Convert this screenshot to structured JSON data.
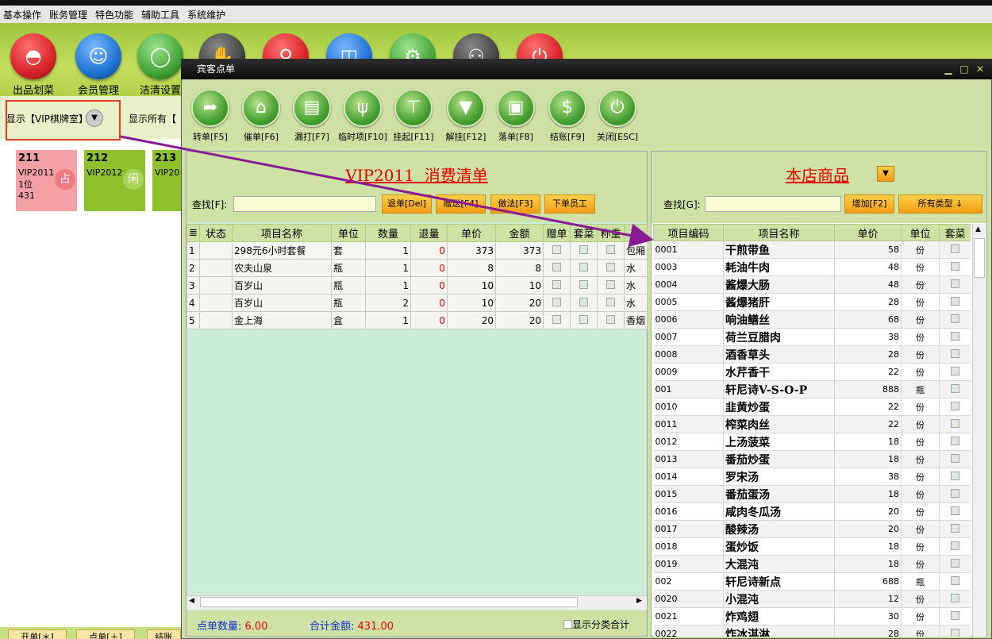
{
  "menu": [
    "基本操作",
    "账务管理",
    "特色功能",
    "辅助工具",
    "系统维护"
  ],
  "main_toolbar": [
    {
      "label": "出品划菜",
      "color": "#d8232a",
      "icon": "cloche-icon"
    },
    {
      "label": "会员管理",
      "color": "#1f74d6",
      "icon": "user-icon"
    },
    {
      "label": "洁清设置",
      "color": "#45a63a",
      "icon": "plate-icon"
    },
    {
      "label": "",
      "color": "#444",
      "icon": "hand-icon"
    },
    {
      "label": "",
      "color": "#d8232a",
      "icon": "search-icon"
    },
    {
      "label": "",
      "color": "#1f74d6",
      "icon": "bag-icon"
    },
    {
      "label": "",
      "color": "#45a63a",
      "icon": "settings-icon"
    },
    {
      "label": "",
      "color": "#444",
      "icon": "people-icon"
    },
    {
      "label": "",
      "color": "#d8232a",
      "icon": "power-icon"
    }
  ],
  "filter": {
    "current": "显示【VIP棋牌室】",
    "show_all": "显示所有【"
  },
  "rooms": [
    {
      "number": "211",
      "name": "VIP2011",
      "guests": "1位",
      "amount": "431",
      "badge": "占",
      "color": "#f4a0a4"
    },
    {
      "number": "212",
      "name": "VIP2012",
      "guests": "",
      "amount": "",
      "badge": "闲",
      "color": "#8dc22c"
    },
    {
      "number": "213",
      "name": "VIP20",
      "guests": "",
      "amount": "",
      "badge": "",
      "color": "#8dc22c"
    }
  ],
  "bottom_buttons": [
    "开单[＊]",
    "点单[＋]",
    "结账"
  ],
  "dialog": {
    "title": "宾客点单",
    "toolbar": [
      {
        "label": "转单[F5]",
        "icon": "forward-icon",
        "glyph": "➦"
      },
      {
        "label": "催单[F6]",
        "icon": "bank-icon",
        "glyph": "⌂"
      },
      {
        "label": "漏打[F7]",
        "icon": "document-icon",
        "glyph": "▤"
      },
      {
        "label": "临时项[F10]",
        "icon": "fork-knife-icon",
        "glyph": "ψ"
      },
      {
        "label": "挂起[F11]",
        "icon": "tie-rack-icon",
        "glyph": "⊤"
      },
      {
        "label": "解挂[F12]",
        "icon": "tie-icon",
        "glyph": "▼"
      },
      {
        "label": "落单[F8]",
        "icon": "screen-icon",
        "glyph": "▣"
      },
      {
        "label": "结账[F9]",
        "icon": "dollar-icon",
        "glyph": "$"
      },
      {
        "label": "关闭[ESC]",
        "icon": "power-icon",
        "glyph": "⏻"
      }
    ],
    "order": {
      "title": "VIP2011  消费清单",
      "search_label": "查找[F]:",
      "buttons": [
        "退单[Del]",
        "赠送[F4]",
        "做法[F3]",
        "下单员工"
      ],
      "columns": [
        "≣",
        "状态",
        "项目名称",
        "单位",
        "数量",
        "退量",
        "单价",
        "金额",
        "赠单",
        "套菜",
        "称重",
        "商"
      ],
      "rows": [
        {
          "idx": "1",
          "status": "",
          "name": "298元6小时套餐",
          "unit": "套",
          "qty": "1",
          "ret": "0",
          "price": "373",
          "amount": "373",
          "extra": "包厢"
        },
        {
          "idx": "2",
          "status": "",
          "name": "农夫山泉",
          "unit": "瓶",
          "qty": "1",
          "ret": "0",
          "price": "8",
          "amount": "8",
          "extra": "水"
        },
        {
          "idx": "3",
          "status": "",
          "name": "百岁山",
          "unit": "瓶",
          "qty": "1",
          "ret": "0",
          "price": "10",
          "amount": "10",
          "extra": "水"
        },
        {
          "idx": "4",
          "status": "",
          "name": "百岁山",
          "unit": "瓶",
          "qty": "2",
          "ret": "0",
          "price": "10",
          "amount": "20",
          "extra": "水"
        },
        {
          "idx": "5",
          "status": "",
          "name": "金上海",
          "unit": "盒",
          "qty": "1",
          "ret": "0",
          "price": "20",
          "amount": "20",
          "extra": "香烟"
        }
      ],
      "count_label": "点单数量:",
      "count_value": "6.00",
      "total_label": "合计金额:",
      "total_value": "431.00",
      "show_category": "显示分类合计"
    },
    "products": {
      "title": "本店商品",
      "search_label": "查找[G]:",
      "add_button": "增加[F2]",
      "type_button": "所有类型 ↓",
      "columns": [
        "项目编码",
        "项目名称",
        "单价",
        "单位",
        "套菜"
      ],
      "rows": [
        {
          "code": "0001",
          "name": "干煎带鱼",
          "price": "58",
          "unit": "份"
        },
        {
          "code": "0003",
          "name": "耗油牛肉",
          "price": "48",
          "unit": "份"
        },
        {
          "code": "0004",
          "name": "酱爆大肠",
          "price": "48",
          "unit": "份"
        },
        {
          "code": "0005",
          "name": "酱爆猪肝",
          "price": "28",
          "unit": "份"
        },
        {
          "code": "0006",
          "name": "响油鳝丝",
          "price": "68",
          "unit": "份"
        },
        {
          "code": "0007",
          "name": "荷兰豆腊肉",
          "price": "38",
          "unit": "份"
        },
        {
          "code": "0008",
          "name": "酒香草头",
          "price": "28",
          "unit": "份"
        },
        {
          "code": "0009",
          "name": "水芹香干",
          "price": "22",
          "unit": "份"
        },
        {
          "code": "001",
          "name": "轩尼诗V-S-O-P",
          "price": "888",
          "unit": "瓶"
        },
        {
          "code": "0010",
          "name": "韭黄炒蛋",
          "price": "22",
          "unit": "份"
        },
        {
          "code": "0011",
          "name": "榨菜肉丝",
          "price": "22",
          "unit": "份"
        },
        {
          "code": "0012",
          "name": "上汤菠菜",
          "price": "18",
          "unit": "份"
        },
        {
          "code": "0013",
          "name": "番茄炒蛋",
          "price": "18",
          "unit": "份"
        },
        {
          "code": "0014",
          "name": "罗宋汤",
          "price": "38",
          "unit": "份"
        },
        {
          "code": "0015",
          "name": "番茄蛋汤",
          "price": "18",
          "unit": "份"
        },
        {
          "code": "0016",
          "name": "咸肉冬瓜汤",
          "price": "20",
          "unit": "份"
        },
        {
          "code": "0017",
          "name": "酸辣汤",
          "price": "20",
          "unit": "份"
        },
        {
          "code": "0018",
          "name": "蛋炒饭",
          "price": "18",
          "unit": "份"
        },
        {
          "code": "0019",
          "name": "大混沌",
          "price": "18",
          "unit": "份"
        },
        {
          "code": "002",
          "name": "轩尼诗新点",
          "price": "688",
          "unit": "瓶"
        },
        {
          "code": "0020",
          "name": "小混沌",
          "price": "12",
          "unit": "份"
        },
        {
          "code": "0021",
          "name": "炸鸡翅",
          "price": "30",
          "unit": "份"
        },
        {
          "code": "0022",
          "name": "炸冰淇淋",
          "price": "28",
          "unit": "份"
        }
      ]
    }
  }
}
